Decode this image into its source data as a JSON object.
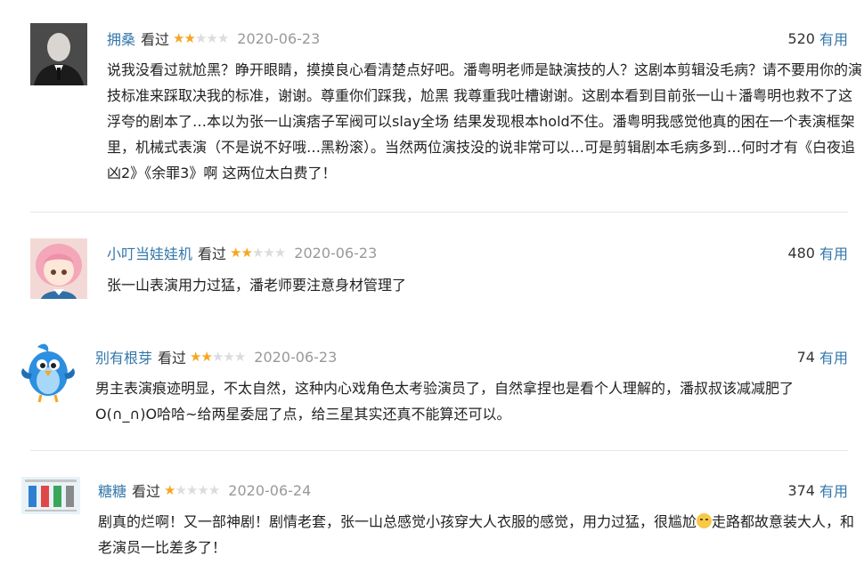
{
  "vote_label": "有用",
  "star_glyph": "★",
  "reviews": [
    {
      "author": "拥桑",
      "status": "看过",
      "rating": 2,
      "date": "2020-06-23",
      "votes": "520",
      "content": "说我没看过就尬黑？睁开眼睛，摸摸良心看清楚点好吧。潘粤明老师是缺演技的人？这剧本剪辑没毛病？请不要用你的演技标准来踩取决我的标准，谢谢。尊重你们踩我，尬黑 我尊重我吐槽谢谢。这剧本看到目前张一山＋潘粤明也救不了这浮夸的剧本了…本以为张一山演痞子军阀可以slay全场 结果发现根本hold不住。潘粤明我感觉他真的困在一个表演框架里，机械式表演（不是说不好哦…黑粉滚）。当然两位演技没的说非常可以…可是剪辑剧本毛病多到…何时才有《白夜追凶2》《余罪3》啊 这两位太白费了！"
    },
    {
      "author": "小叮当娃娃机",
      "status": "看过",
      "rating": 2,
      "date": "2020-06-23",
      "votes": "480",
      "content": "张一山表演用力过猛，潘老师要注意身材管理了"
    },
    {
      "author": "别有根芽",
      "status": "看过",
      "rating": 2,
      "date": "2020-06-23",
      "votes": "74",
      "content": "男主表演痕迹明显，不太自然，这种内心戏角色太考验演员了，自然拿捏也是看个人理解的，潘叔叔该减减肥了O(∩_∩)O哈哈~给两星委屈了点，给三星其实还真不能算还可以。"
    },
    {
      "author": "糖糖",
      "status": "看过",
      "rating": 1,
      "date": "2020-06-24",
      "votes": "374",
      "content_a": "剧真的烂啊！又一部神剧！剧情老套，张一山总感觉小孩穿大人衣服的感觉，用力过猛，很尴尬",
      "content_b": "走路都故意装大人，和老演员一比差多了！"
    }
  ]
}
